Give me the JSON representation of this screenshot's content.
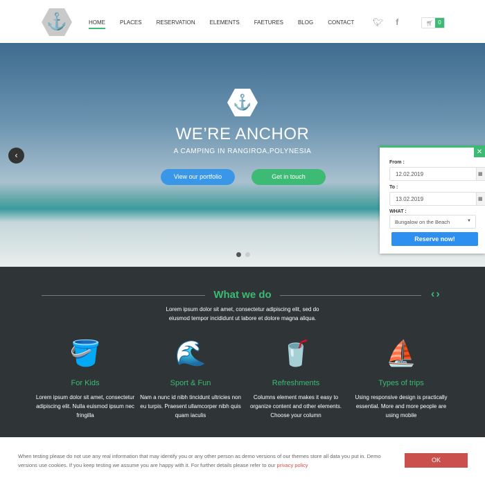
{
  "header": {
    "logo_glyph": "⚓",
    "nav": [
      "HOME",
      "PLACES",
      "RESERVATION",
      "ELEMENTS",
      "FAETURES",
      "BLOG",
      "CONTACT"
    ],
    "cart_count": "0"
  },
  "hero": {
    "logo_glyph": "⚓",
    "title": "WE’RE ANCHOR",
    "subtitle": "A CAMPING IN RANGIROA,POLYNESIA",
    "portfolio_btn": "View our portfolio",
    "contact_btn": "Get in touch",
    "active_slide": 1,
    "slide_count": 2
  },
  "reservation": {
    "from_label": "From :",
    "from_value": "12.02.2019",
    "to_label": "To :",
    "to_value": "13.02.2019",
    "what_label": "WHAT :",
    "what_value": "Bungalow on the Beach",
    "submit": "Reserve now!"
  },
  "what_we_do": {
    "title": "What we do",
    "description": "Lorem ipsum dolor sit amet, consectetur adipiscing elit, sed do eiusmod tempor incididunt ut labore et dolore magna aliqua.",
    "features": [
      {
        "icon": "bucket-icon",
        "glyph": "🪣",
        "title": "For Kids",
        "text": "Lorem ipsum dolor sit amet, consectetur adipiscing elit. Nulla euismod ipsum nec fringilla"
      },
      {
        "icon": "jetski-icon",
        "glyph": "🌊",
        "title": "Sport & Fun",
        "text": "Nam a nunc id nibh tincidunt ultricies non eu turpis. Praesent ullamcorper nibh quis quam iaculis"
      },
      {
        "icon": "drink-icon",
        "glyph": "🥤",
        "title": "Refreshments",
        "text": "Columns element makes it easy to organize content and other elements. Choose your column"
      },
      {
        "icon": "sailboat-icon",
        "glyph": "⛵",
        "title": "Types of trips",
        "text": "Using responsive design is practically essential. More and more people are using mobile"
      }
    ]
  },
  "cookie": {
    "text": "When testing please do not use any real information that may identify you or any other person as demo versions of our themes store all data you put in. Demo versions use cookies. If you keep testing we assume you are happy with it. For further details please refer to our ",
    "link": "privacy policy",
    "ok": "OK"
  },
  "colors": {
    "accent": "#3dba74",
    "blue": "#3a97e8",
    "dark": "#2f3437",
    "cookie_btn": "#c9504c"
  }
}
